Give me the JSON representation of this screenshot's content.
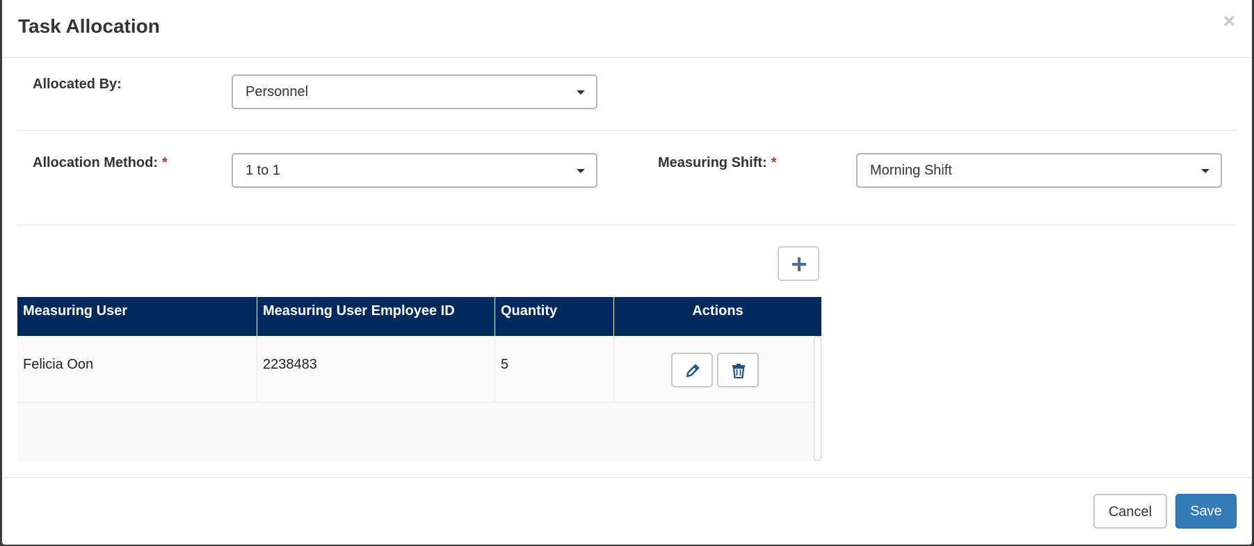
{
  "modal": {
    "title": "Task Allocation",
    "close_glyph": "×"
  },
  "form": {
    "allocated_by": {
      "label": "Allocated By:",
      "value": "Personnel"
    },
    "allocation_method": {
      "label": "Allocation Method:",
      "required_mark": "*",
      "value": "1 to 1"
    },
    "measuring_shift": {
      "label": "Measuring Shift:",
      "required_mark": "*",
      "value": "Morning Shift"
    }
  },
  "grid": {
    "add_icon": "plus-icon",
    "columns": [
      "Measuring User",
      "Measuring User Employee ID",
      "Quantity",
      "Actions"
    ],
    "rows": [
      {
        "user": "Felicia Oon",
        "employee_id": "2238483",
        "quantity": "5"
      }
    ],
    "row_actions": [
      "pencil-icon",
      "trash-icon"
    ]
  },
  "footer": {
    "cancel_label": "Cancel",
    "save_label": "Save"
  },
  "colors": {
    "header_bg": "#002a5c",
    "primary": "#337ab7",
    "required": "#c9302c",
    "icon": "#1f4f87"
  }
}
